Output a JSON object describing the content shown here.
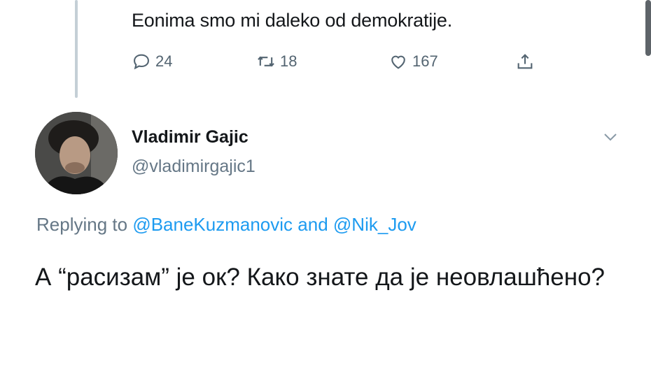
{
  "previous_tweet": {
    "text": "Eonima smo mi daleko od demokratije.",
    "reply_count": "24",
    "retweet_count": "18",
    "like_count": "167",
    "icons": [
      "reply-icon",
      "retweet-icon",
      "like-icon",
      "share-icon"
    ]
  },
  "reply_tweet": {
    "display_name": "Vladimir Gajic",
    "handle": "@vladimirgajic1",
    "replying_prefix": "Replying to",
    "mention_1": "@BaneKuzmanovic",
    "connector": "and",
    "mention_2": "@Nik_Jov",
    "text": "А “расизам” је ок? Како знате да је неовлашћено?"
  },
  "colors": {
    "accent": "#1d9bf0",
    "secondary_text": "#657786",
    "primary_text": "#14171a",
    "thread_line": "#c4cfd6"
  }
}
